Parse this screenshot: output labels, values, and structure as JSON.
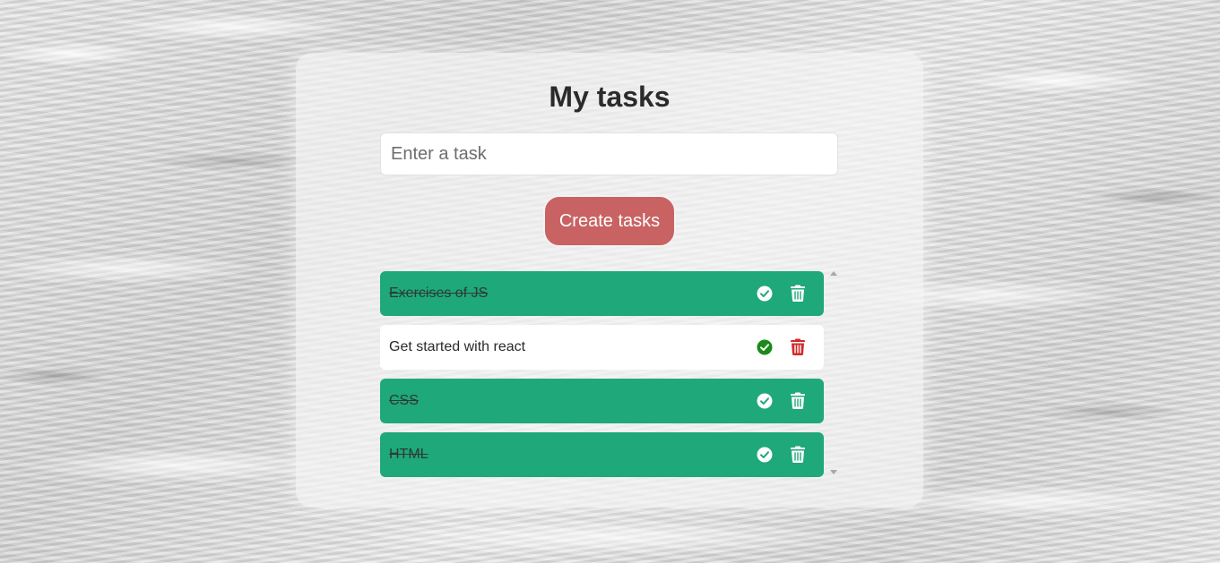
{
  "page": {
    "title": "My tasks"
  },
  "form": {
    "input_placeholder": "Enter a task",
    "input_value": "",
    "create_button_label": "Create tasks"
  },
  "tasks": [
    {
      "text": "Exercises of JS",
      "completed": true
    },
    {
      "text": "Get started with react",
      "completed": false
    },
    {
      "text": "CSS",
      "completed": true
    },
    {
      "text": "HTML",
      "completed": true
    }
  ],
  "icons": {
    "complete": "check-circle-icon",
    "delete": "trash-icon"
  },
  "colors": {
    "completed_task_bg": "#1fa87a",
    "pending_task_bg": "#ffffff",
    "create_button_bg": "#c96262",
    "pending_check_color": "#1a8a1a",
    "pending_trash_color": "#d02b2b",
    "completed_icon_color": "#ffffff"
  }
}
